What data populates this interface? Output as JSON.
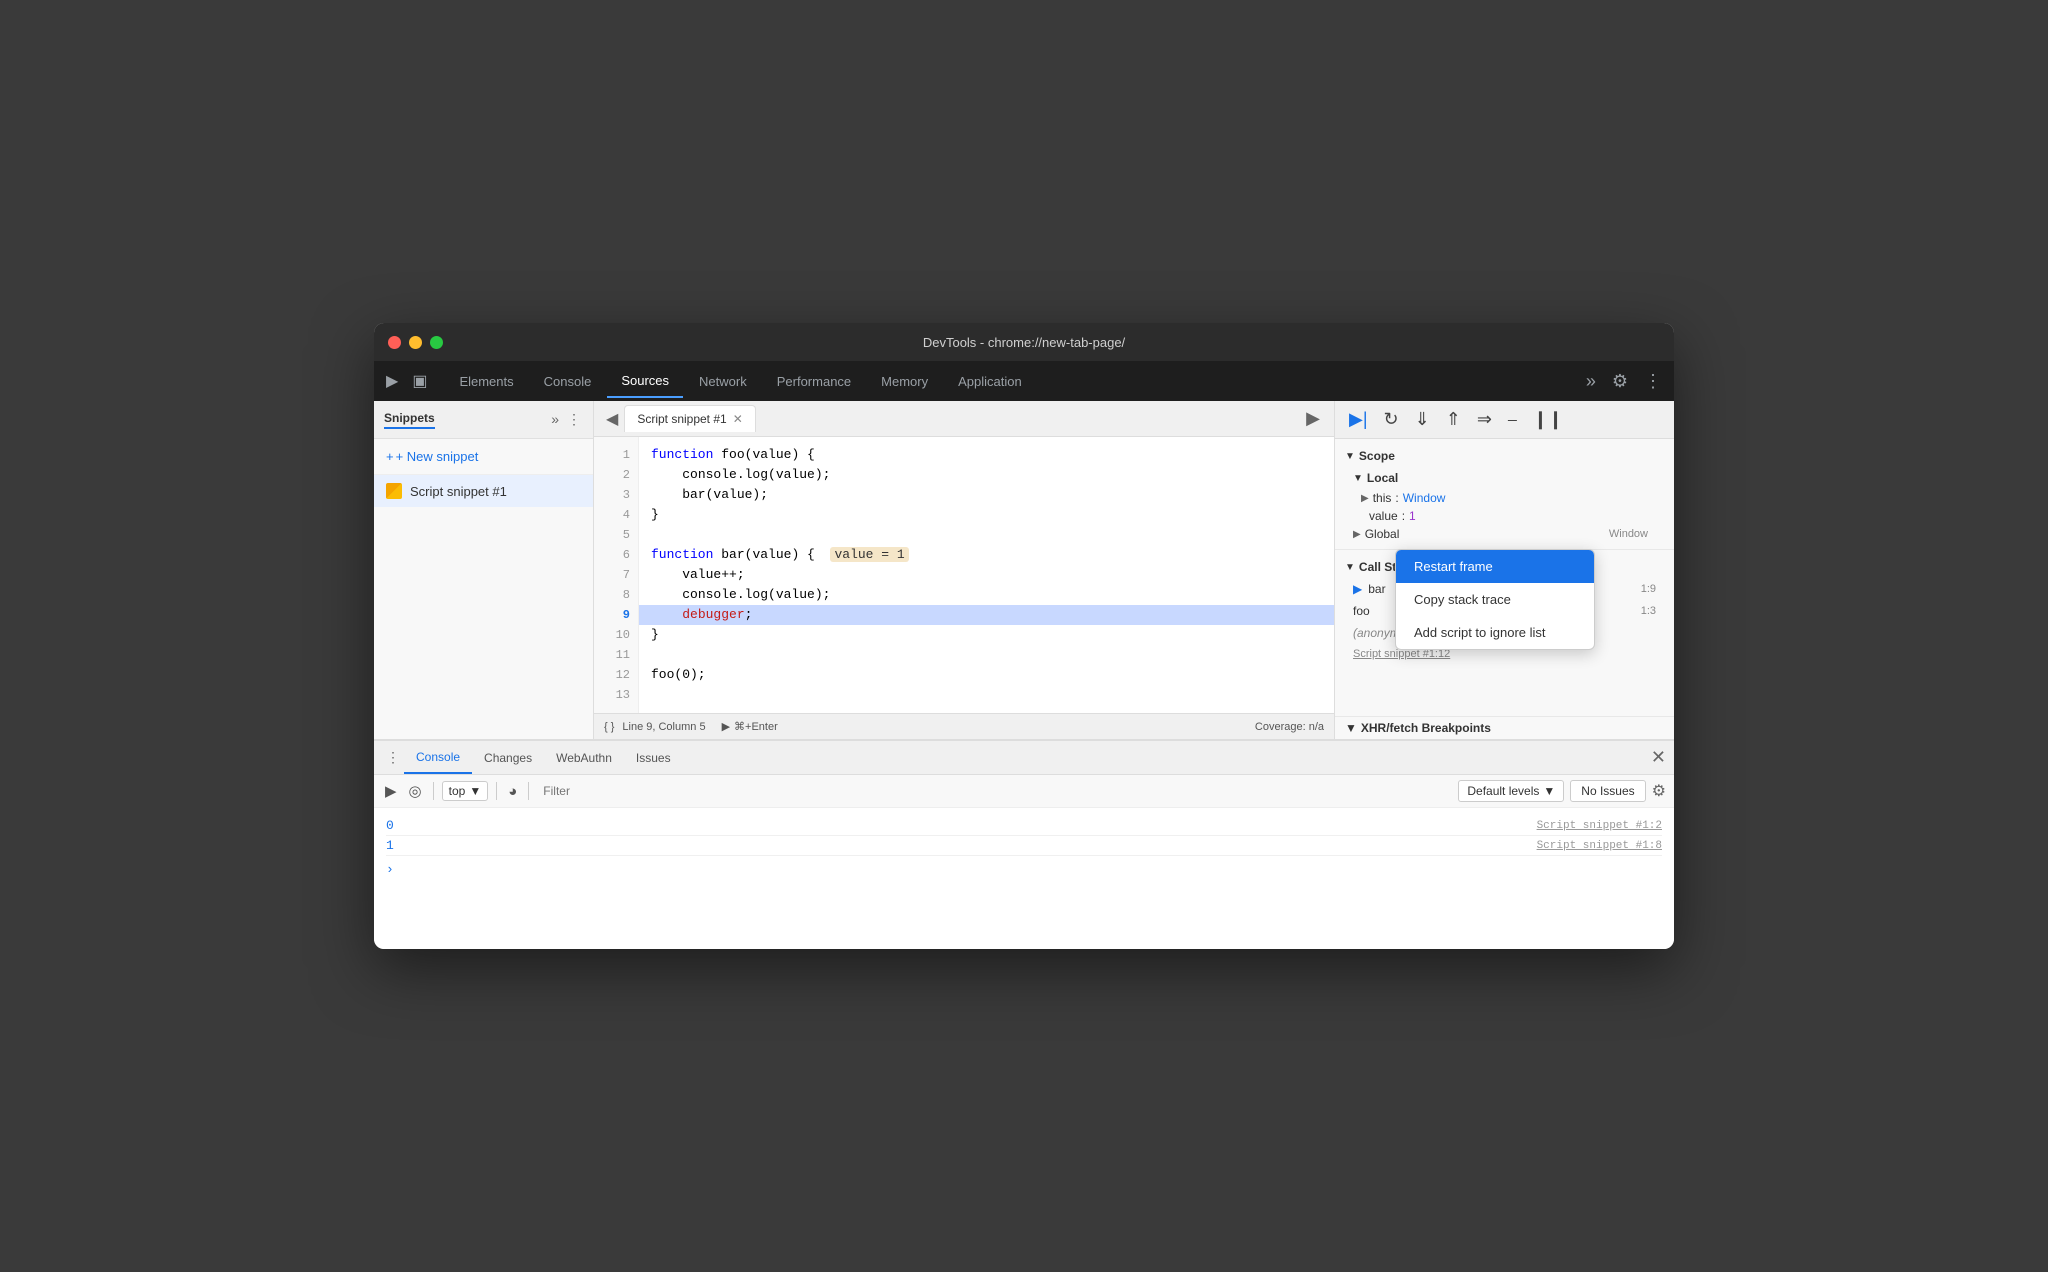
{
  "window": {
    "title": "DevTools - chrome://new-tab-page/"
  },
  "tabs": {
    "items": [
      {
        "label": "Elements",
        "active": false
      },
      {
        "label": "Console",
        "active": false
      },
      {
        "label": "Sources",
        "active": true
      },
      {
        "label": "Network",
        "active": false
      },
      {
        "label": "Performance",
        "active": false
      },
      {
        "label": "Memory",
        "active": false
      },
      {
        "label": "Application",
        "active": false
      }
    ]
  },
  "sidebar": {
    "title": "Snippets",
    "new_snippet_label": "+ New snippet",
    "snippet_name": "Script snippet #1"
  },
  "editor": {
    "tab_label": "Script snippet #1",
    "lines": [
      {
        "num": "1",
        "code": "function foo(value) {",
        "highlight": false,
        "debugger": false
      },
      {
        "num": "2",
        "code": "    console.log(value);",
        "highlight": false,
        "debugger": false
      },
      {
        "num": "3",
        "code": "    bar(value);",
        "highlight": false,
        "debugger": false
      },
      {
        "num": "4",
        "code": "}",
        "highlight": false,
        "debugger": false
      },
      {
        "num": "5",
        "code": "",
        "highlight": false,
        "debugger": false
      },
      {
        "num": "6",
        "code": "function bar(value) {",
        "highlight": true,
        "debugger": false
      },
      {
        "num": "7",
        "code": "    value++;",
        "highlight": false,
        "debugger": false
      },
      {
        "num": "8",
        "code": "    console.log(value);",
        "highlight": false,
        "debugger": false
      },
      {
        "num": "9",
        "code": "    debugger;",
        "highlight": false,
        "debugger": true
      },
      {
        "num": "10",
        "code": "}",
        "highlight": false,
        "debugger": false
      },
      {
        "num": "11",
        "code": "",
        "highlight": false,
        "debugger": false
      },
      {
        "num": "12",
        "code": "foo(0);",
        "highlight": false,
        "debugger": false
      },
      {
        "num": "13",
        "code": "",
        "highlight": false,
        "debugger": false
      }
    ],
    "status": {
      "line_col": "Line 9, Column 5",
      "run": "⌘+Enter",
      "coverage": "Coverage: n/a"
    }
  },
  "right_panel": {
    "scope": {
      "title": "Scope",
      "local_title": "Local",
      "this_key": "this",
      "this_val": "Window",
      "value_key": "value",
      "value_val": "1",
      "global_title": "Global",
      "global_val": "Window"
    },
    "call_stack": {
      "title": "Call Stack",
      "items": [
        {
          "name": "bar",
          "loc": "1:9"
        },
        {
          "name": "foo",
          "loc": "1:3"
        },
        {
          "name": "(anonymous)",
          "loc": ""
        },
        {
          "name": "Script snippet #1:12",
          "loc": ""
        }
      ]
    }
  },
  "context_menu": {
    "items": [
      {
        "label": "Restart frame",
        "selected": true
      },
      {
        "label": "Copy stack trace",
        "selected": false
      },
      {
        "label": "Add script to ignore list",
        "selected": false
      }
    ]
  },
  "bottom_panel": {
    "tabs": [
      {
        "label": "Console",
        "active": true
      },
      {
        "label": "Changes",
        "active": false
      },
      {
        "label": "WebAuthn",
        "active": false
      },
      {
        "label": "Issues",
        "active": false
      }
    ],
    "console": {
      "top_label": "top",
      "filter_placeholder": "Filter",
      "default_levels": "Default levels",
      "no_issues": "No Issues",
      "output": [
        {
          "value": "0",
          "source": "Script snippet #1:2"
        },
        {
          "value": "1",
          "source": "Script snippet #1:8"
        }
      ]
    }
  }
}
